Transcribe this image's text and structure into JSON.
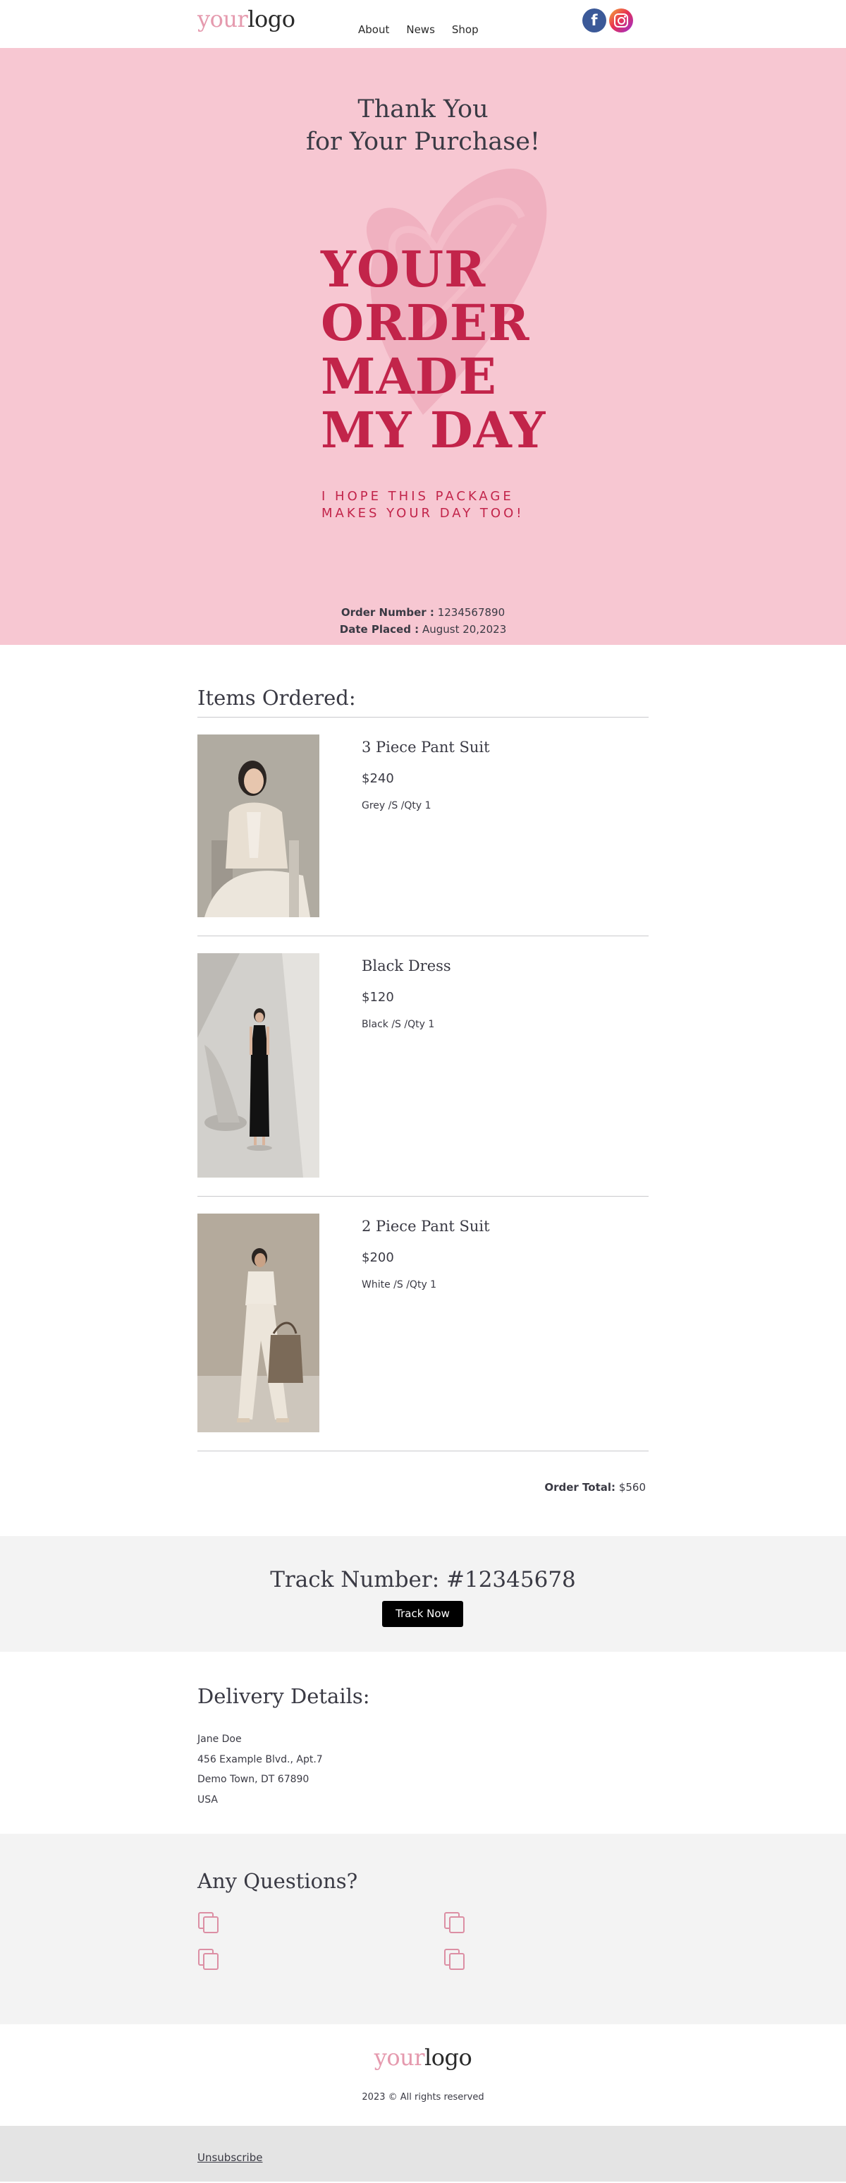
{
  "header": {
    "logo_part1": "your",
    "logo_part2": "logo",
    "nav": [
      "About",
      "News",
      "Shop"
    ],
    "social": [
      "facebook-icon",
      "instagram-icon"
    ]
  },
  "hero": {
    "title_line1": "Thank You",
    "title_line2": "for Your Purchase!",
    "headline": [
      "YOUR",
      "ORDER",
      "MADE",
      "MY DAY"
    ],
    "tagline_line1": "I HOPE THIS PACKAGE",
    "tagline_line2": "MAKES YOUR DAY TOO!",
    "order_number_label": "Order Number :",
    "order_number": "1234567890",
    "date_label": "Date Placed :",
    "date": "August 20,2023",
    "colors": {
      "background": "#f7c7d2",
      "accent": "#c2244a",
      "heart": "#eea9b9"
    }
  },
  "items_section": {
    "title": "Items Ordered:",
    "items": [
      {
        "name": "3 Piece Pant Suit",
        "price": "$240",
        "options": "Grey /S /Qty 1"
      },
      {
        "name": "Black Dress",
        "price": "$120",
        "options": "Black /S /Qty 1"
      },
      {
        "name": "2 Piece Pant Suit",
        "price": "$200",
        "options": "White /S /Qty 1"
      }
    ],
    "total_label": "Order Total:",
    "total_value": "$560"
  },
  "tracking": {
    "title": "Track Number: #12345678",
    "button": "Track Now"
  },
  "delivery": {
    "title": "Delivery Details:",
    "lines": [
      "Jane Doe",
      "456 Example Blvd., Apt.7",
      "Demo Town, DT 67890",
      "USA"
    ]
  },
  "questions": {
    "title": "Any Questions?",
    "icons": [
      "copy-icon",
      "copy-icon",
      "copy-icon",
      "copy-icon"
    ]
  },
  "footer": {
    "logo_part1": "your",
    "logo_part2": "logo",
    "copyright": "2023 © All rights reserved",
    "unsubscribe": "Unsubscribe"
  }
}
